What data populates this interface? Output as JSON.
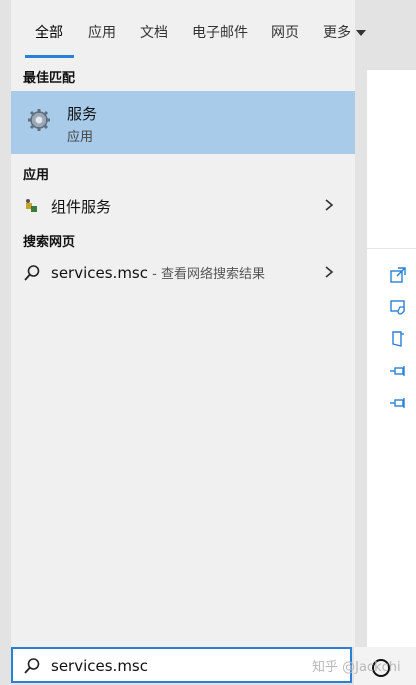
{
  "tabs": [
    {
      "label": "全部",
      "active": true
    },
    {
      "label": "应用",
      "active": false
    },
    {
      "label": "文档",
      "active": false
    },
    {
      "label": "电子邮件",
      "active": false
    },
    {
      "label": "网页",
      "active": false
    },
    {
      "label": "更多",
      "active": false
    }
  ],
  "sections": {
    "best_match": "最佳匹配",
    "apps": "应用",
    "web": "搜索网页"
  },
  "best_match": {
    "title": "服务",
    "subtitle": "应用",
    "icon": "gear-icon"
  },
  "apps": [
    {
      "label": "组件服务",
      "icon": "component-services-icon"
    }
  ],
  "web": [
    {
      "query": "services.msc",
      "suffix": " - 查看网络搜索结果",
      "icon": "search-icon"
    }
  ],
  "search": {
    "value": "services.msc",
    "icon": "search-icon"
  },
  "watermark": "知乎 @Jackchi",
  "colors": {
    "accent": "#2a7fd6",
    "selected": "#a8cbea",
    "panel": "#f0f0f0"
  }
}
